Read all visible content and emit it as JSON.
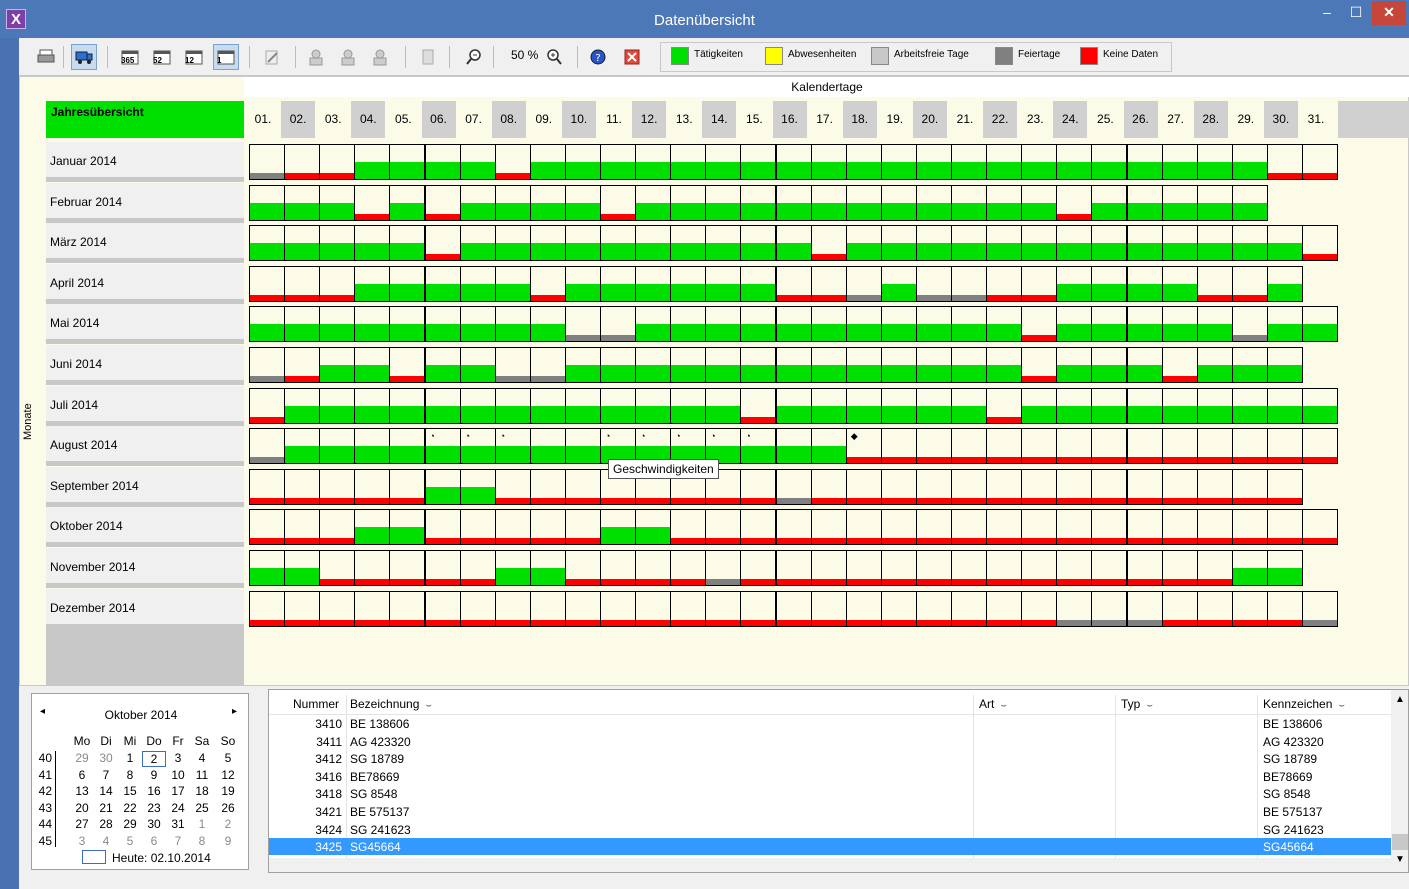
{
  "window": {
    "title": "Datenübersicht",
    "app_icon": "X",
    "minimize": "–",
    "maximize": "☐",
    "close": "✕"
  },
  "toolbar": {
    "buttons": [
      {
        "name": "print-icon",
        "active": false
      },
      {
        "name": "truck-icon",
        "active": true
      },
      {
        "name": "calendar-365-icon",
        "label": "365",
        "active": false
      },
      {
        "name": "calendar-52-icon",
        "label": "52",
        "active": false
      },
      {
        "name": "calendar-12-icon",
        "label": "12",
        "active": false
      },
      {
        "name": "calendar-1-icon",
        "label": "1",
        "active": true
      },
      {
        "name": "edit-icon",
        "active": false
      },
      {
        "name": "driver-icon",
        "active": false
      },
      {
        "name": "driver-edit-icon",
        "active": false
      },
      {
        "name": "driver-delete-icon",
        "active": false
      },
      {
        "name": "document-icon",
        "active": false
      },
      {
        "name": "zoom-out-icon",
        "active": false
      },
      {
        "name": "zoom-in-icon",
        "active": false
      },
      {
        "name": "help-icon",
        "active": false
      },
      {
        "name": "close-red-icon",
        "active": false
      }
    ],
    "zoom": "50 %",
    "legend": [
      {
        "label": "Tätigkeiten",
        "color": "#00e000"
      },
      {
        "label": "Abwesenheiten",
        "color": "#ffff00"
      },
      {
        "label": "Arbeitsfreie Tage",
        "color": "#c8c8c8"
      },
      {
        "label": "Feiertage",
        "color": "#808080"
      },
      {
        "label": "Keine Daten",
        "color": "#ff0000"
      }
    ]
  },
  "grid": {
    "kalendertage_label": "Kalendertage",
    "monate_label": "Monate",
    "year_header": "Jahresübersicht",
    "days": [
      "01.",
      "02.",
      "03.",
      "04.",
      "05.",
      "06.",
      "07.",
      "08.",
      "09.",
      "10.",
      "11.",
      "12.",
      "13.",
      "14.",
      "15.",
      "16.",
      "17.",
      "18.",
      "19.",
      "20.",
      "21.",
      "22.",
      "23.",
      "24.",
      "25.",
      "26.",
      "27.",
      "28.",
      "29.",
      "30.",
      "31."
    ],
    "tooltip": "Geschwindigkeiten",
    "months": [
      {
        "label": "Januar 2014",
        "status": "DRRGGGGRGGGGGGGGGGGGGGGGGGGGGRR"
      },
      {
        "label": "Februar 2014",
        "status": "GGGRGRGGGGRGGGGGGGGGGGGRGGGGG"
      },
      {
        "label": "März 2014",
        "status": "GGGGGRGGGGGGGGGGRGGGGGGGGGGGGGR"
      },
      {
        "label": "April 2014",
        "status": "RRRGGGGGRGGGGGGRRDGDDRRGGGGRRG"
      },
      {
        "label": "Mai 2014",
        "status": "GGGGGGGGGDDGGGGGGGGGGGRGGGGGDGG"
      },
      {
        "label": "Juni 2014",
        "status": "DRGGRGGDDGGGGGGGGGGGGGRGGGRGGG"
      },
      {
        "label": "Juli 2014",
        "status": "RGGGGGGGGGGGGGRGGGGGGRGGGGGGGGG"
      },
      {
        "label": "August 2014",
        "status": "DGGGGGGGGGGGGGGGGRRRRRRRRRRRRRR"
      },
      {
        "label": "September 2014",
        "status": "RRRRRGGRRRRRRRRDRRRRRRRRRRRRRR"
      },
      {
        "label": "Oktober 2014",
        "status": "RRRGGRRRRRGGRRRRRRRRRRRRRRRRRRR"
      },
      {
        "label": "November 2014",
        "status": "GGRRRRRGGRRRRDRRRRRRRRRRRRRRGG"
      },
      {
        "label": "Dezember 2014",
        "status": "RRRRRRRRRRRRRRRRRRRRRRRDDDRRRRD"
      }
    ]
  },
  "calendar": {
    "title": "Oktober 2014",
    "prev": "◂",
    "next": "▸",
    "weekdays": [
      "Mo",
      "Di",
      "Mi",
      "Do",
      "Fr",
      "Sa",
      "So"
    ],
    "weeks": [
      {
        "kw": "40",
        "days": [
          "29",
          "30",
          "1",
          "2",
          "3",
          "4",
          "5"
        ]
      },
      {
        "kw": "41",
        "days": [
          "6",
          "7",
          "8",
          "9",
          "10",
          "11",
          "12"
        ]
      },
      {
        "kw": "42",
        "days": [
          "13",
          "14",
          "15",
          "16",
          "17",
          "18",
          "19"
        ]
      },
      {
        "kw": "43",
        "days": [
          "20",
          "21",
          "22",
          "23",
          "24",
          "25",
          "26"
        ]
      },
      {
        "kw": "44",
        "days": [
          "27",
          "28",
          "29",
          "30",
          "31",
          "1",
          "2"
        ]
      },
      {
        "kw": "45",
        "days": [
          "3",
          "4",
          "5",
          "6",
          "7",
          "8",
          "9"
        ]
      }
    ],
    "today": "Heute: 02.10.2014"
  },
  "table": {
    "columns": [
      {
        "label": "Nummer"
      },
      {
        "label": "Bezeichnung"
      },
      {
        "label": "Art"
      },
      {
        "label": "Typ"
      },
      {
        "label": "Kennzeichen"
      }
    ],
    "rows": [
      {
        "nummer": "3410",
        "bezeichnung": "BE 138606",
        "kennzeichen": "BE 138606"
      },
      {
        "nummer": "3411",
        "bezeichnung": "AG 423320",
        "kennzeichen": "AG 423320"
      },
      {
        "nummer": "3412",
        "bezeichnung": "SG 18789",
        "kennzeichen": "SG 18789"
      },
      {
        "nummer": "3416",
        "bezeichnung": "BE78669",
        "kennzeichen": "BE78669"
      },
      {
        "nummer": "3418",
        "bezeichnung": "SG 8548",
        "kennzeichen": "SG 8548"
      },
      {
        "nummer": "3421",
        "bezeichnung": "BE 575137",
        "kennzeichen": "BE 575137"
      },
      {
        "nummer": "3424",
        "bezeichnung": "SG 241623",
        "kennzeichen": "SG 241623"
      },
      {
        "nummer": "3425",
        "bezeichnung": "SG45664",
        "kennzeichen": "SG45664"
      }
    ]
  },
  "scroll": {
    "up": "▲",
    "down": "▼"
  }
}
